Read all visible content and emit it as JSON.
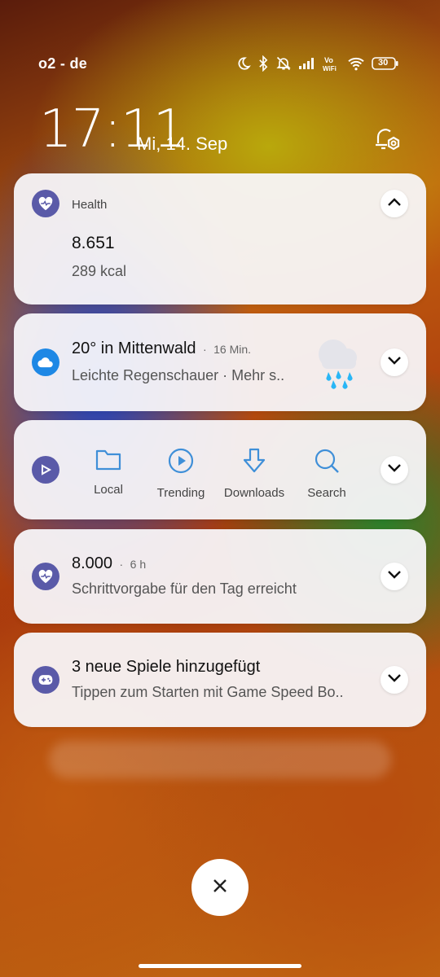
{
  "status_bar": {
    "carrier": "o2 - de",
    "battery": "30",
    "icons": [
      "moon-icon",
      "bluetooth-icon",
      "muted-bell-icon",
      "signal-icon",
      "vowifi-icon",
      "wifi-icon",
      "battery-icon"
    ]
  },
  "lockscreen": {
    "time": "17:11",
    "date": "Mi, 14. Sep"
  },
  "notifications": [
    {
      "app": "Health",
      "title": "8.651",
      "text": "289 kcal",
      "expanded": true
    },
    {
      "title": "20° in Mittenwald",
      "separator": "·",
      "time": "16 Min.",
      "text": "Leichte Regenschauer · Mehr s..",
      "icon": "cloud-icon"
    },
    {
      "actions": [
        {
          "label": "Local",
          "icon": "folder-icon"
        },
        {
          "label": "Trending",
          "icon": "play-circle-icon"
        },
        {
          "label": "Downloads",
          "icon": "download-icon"
        },
        {
          "label": "Search",
          "icon": "search-icon"
        }
      ]
    },
    {
      "title": "8.000",
      "separator": "·",
      "time": "6 h",
      "text": "Schrittvorgabe für den Tag erreicht"
    },
    {
      "title": "3 neue Spiele hinzugefügt",
      "text": "Tippen zum Starten mit Game Speed Bo.."
    }
  ],
  "colors": {
    "health_icon": "#5a5aa8",
    "weather_icon": "#1e88e5",
    "player_icon": "#5a5aa8",
    "accent_blue": "#3f8fd8"
  }
}
